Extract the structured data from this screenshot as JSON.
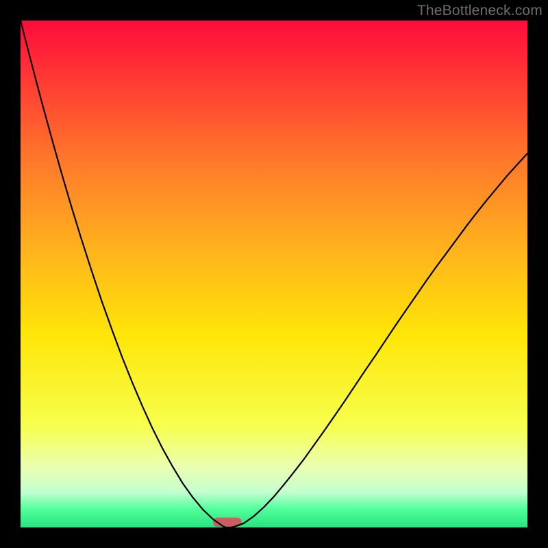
{
  "watermark": "TheBottleneck.com",
  "chart_data": {
    "type": "line",
    "title": "",
    "xlabel": "",
    "ylabel": "",
    "xlim": [
      0,
      1
    ],
    "ylim": [
      0,
      1
    ],
    "x": [
      0.0,
      0.02,
      0.04,
      0.06,
      0.08,
      0.1,
      0.12,
      0.14,
      0.16,
      0.18,
      0.2,
      0.22,
      0.24,
      0.26,
      0.28,
      0.3,
      0.32,
      0.34,
      0.36,
      0.38,
      0.4,
      0.405,
      0.41,
      0.415,
      0.42,
      0.44,
      0.46,
      0.48,
      0.5,
      0.52,
      0.54,
      0.56,
      0.58,
      0.6,
      0.62,
      0.64,
      0.66,
      0.68,
      0.7,
      0.72,
      0.74,
      0.76,
      0.78,
      0.8,
      0.82,
      0.84,
      0.86,
      0.88,
      0.9,
      0.92,
      0.94,
      0.96,
      0.98,
      1.0
    ],
    "y": [
      1.0,
      0.922,
      0.846,
      0.773,
      0.702,
      0.634,
      0.569,
      0.507,
      0.447,
      0.391,
      0.337,
      0.287,
      0.24,
      0.196,
      0.156,
      0.12,
      0.087,
      0.059,
      0.035,
      0.016,
      0.002,
      0.0,
      0.0,
      0.0,
      0.001,
      0.008,
      0.022,
      0.04,
      0.061,
      0.085,
      0.11,
      0.136,
      0.164,
      0.192,
      0.221,
      0.25,
      0.28,
      0.31,
      0.339,
      0.369,
      0.399,
      0.428,
      0.457,
      0.486,
      0.514,
      0.541,
      0.568,
      0.595,
      0.621,
      0.646,
      0.67,
      0.694,
      0.716,
      0.738
    ],
    "gradient_stops": [
      {
        "offset": 0.0,
        "color": "#ff0b3d"
      },
      {
        "offset": 0.12,
        "color": "#ff3b33"
      },
      {
        "offset": 0.28,
        "color": "#ff7a2a"
      },
      {
        "offset": 0.45,
        "color": "#ffb21d"
      },
      {
        "offset": 0.62,
        "color": "#fee607"
      },
      {
        "offset": 0.8,
        "color": "#f7ff4d"
      },
      {
        "offset": 0.88,
        "color": "#eaffb0"
      },
      {
        "offset": 0.93,
        "color": "#c4ffd0"
      },
      {
        "offset": 0.965,
        "color": "#4fff9a"
      },
      {
        "offset": 1.0,
        "color": "#27e37e"
      }
    ],
    "marker": {
      "x_center": 0.408,
      "width": 0.056,
      "height": 0.018,
      "color": "#cd5d63"
    }
  }
}
